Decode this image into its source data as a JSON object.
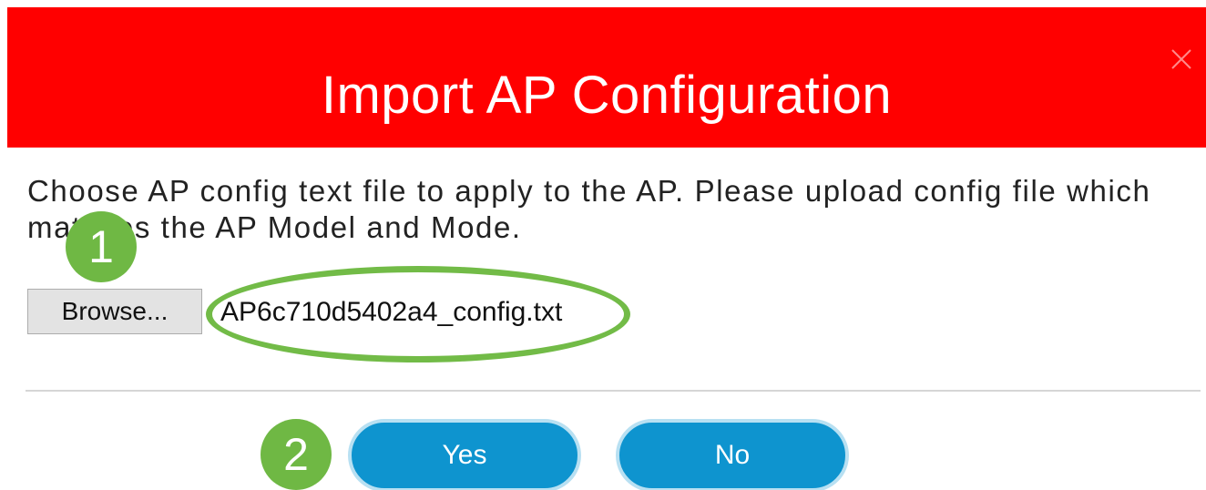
{
  "dialog": {
    "title": "Import AP Configuration",
    "description": "Choose AP config text file to apply to the AP. Please upload config file which matches the AP Model and Mode.",
    "header_color": "#ff0000"
  },
  "file_input": {
    "browse_label": "Browse...",
    "file_name": "AP6c710d5402a4_config.txt"
  },
  "annotations": {
    "step_1": "1",
    "step_2": "2",
    "callout_color": "#6fb844"
  },
  "actions": {
    "yes_label": "Yes",
    "no_label": "No",
    "button_color": "#0e94cf"
  },
  "icons": {
    "close": "close-icon"
  }
}
